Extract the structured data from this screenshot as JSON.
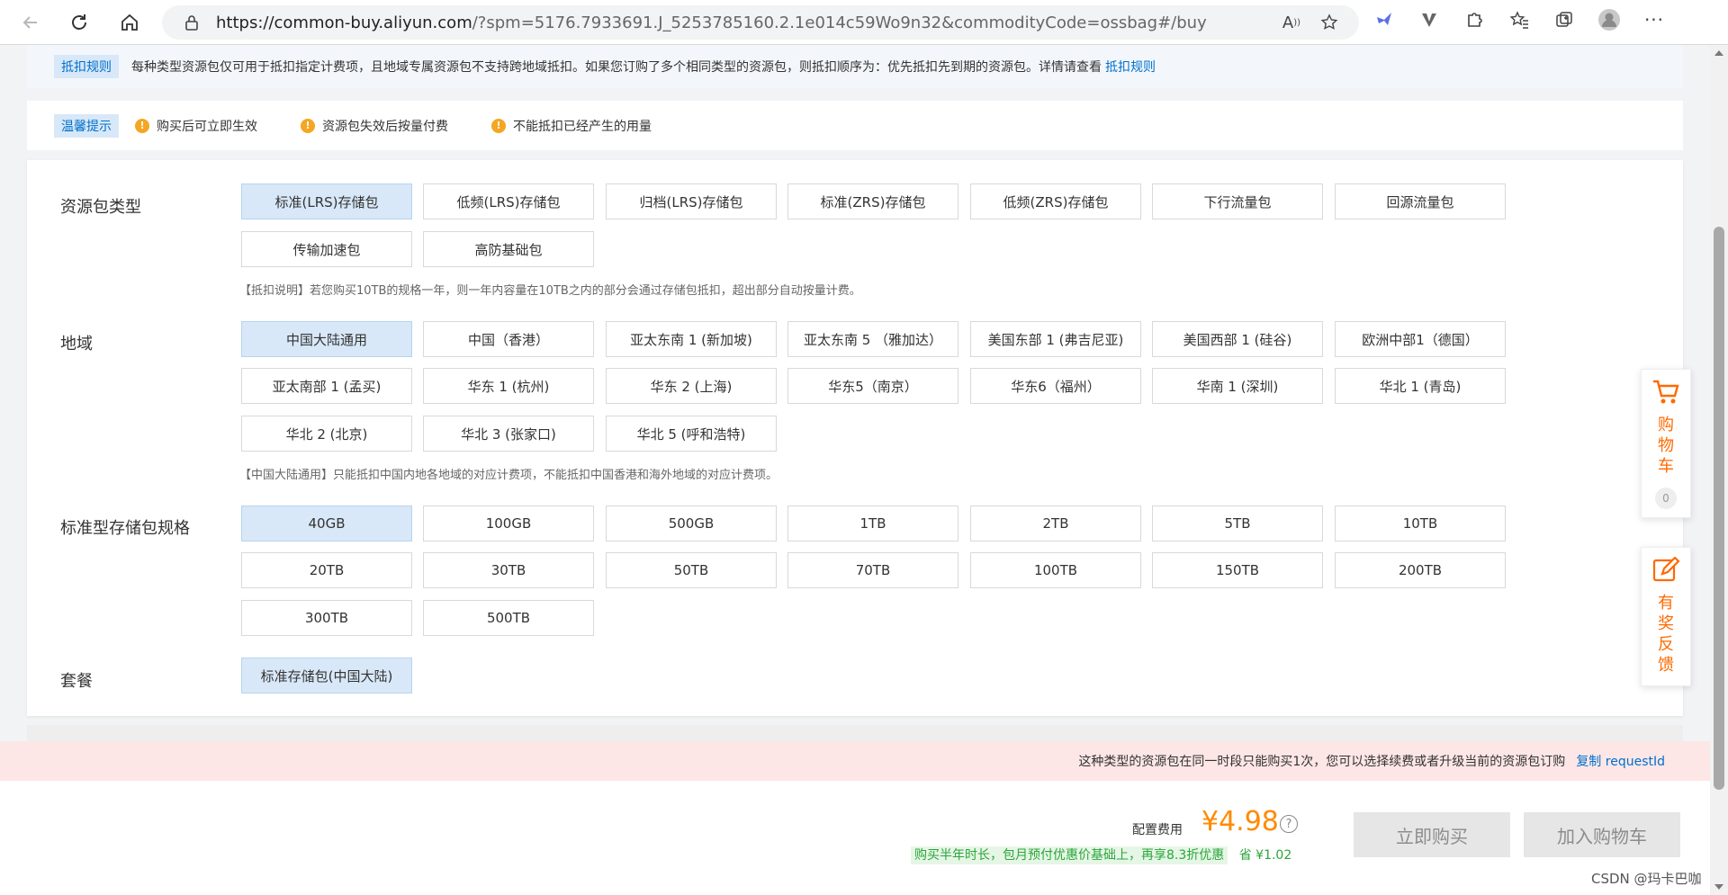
{
  "browser": {
    "url_host": "https://common-buy.aliyun.com",
    "url_rest": "/?spm=5176.7933691.J_5253785160.2.1e014c59Wo9n32&commodityCode=ossbag#/buy"
  },
  "rules": {
    "tag": "抵扣规则",
    "text": "每种类型资源包仅可用于抵扣指定计费项，且地域专属资源包不支持跨地域抵扣。如果您订购了多个相同类型的资源包，则抵扣顺序为：优先抵扣先到期的资源包。详情请查看",
    "link": "抵扣规则"
  },
  "tips": {
    "tag": "温馨提示",
    "items": [
      "购买后可立即生效",
      "资源包失效后按量付费",
      "不能抵扣已经产生的用量"
    ]
  },
  "package_type": {
    "label": "资源包类型",
    "options": [
      "标准(LRS)存储包",
      "低频(LRS)存储包",
      "归档(LRS)存储包",
      "标准(ZRS)存储包",
      "低频(ZRS)存储包",
      "下行流量包",
      "回源流量包",
      "传输加速包",
      "高防基础包"
    ],
    "selected": "标准(LRS)存储包",
    "note": "【抵扣说明】若您购买10TB的规格一年，则一年内容量在10TB之内的部分会通过存储包抵扣，超出部分自动按量计费。"
  },
  "region": {
    "label": "地域",
    "options": [
      "中国大陆通用",
      "中国（香港）",
      "亚太东南 1 (新加坡)",
      "亚太东南 5 （雅加达）",
      "美国东部 1 (弗吉尼亚)",
      "美国西部 1 (硅谷)",
      "欧洲中部1（德国）",
      "亚太南部 1 (孟买)",
      "华东 1 (杭州)",
      "华东 2 (上海)",
      "华东5（南京）",
      "华东6（福州）",
      "华南 1 (深圳)",
      "华北 1 (青岛)",
      "华北 2 (北京)",
      "华北 3 (张家口)",
      "华北 5 (呼和浩特)"
    ],
    "selected": "中国大陆通用",
    "note": "【中国大陆通用】只能抵扣中国内地各地域的对应计费项，不能抵扣中国香港和海外地域的对应计费项。"
  },
  "spec": {
    "label": "标准型存储包规格",
    "options": [
      "40GB",
      "100GB",
      "500GB",
      "1TB",
      "2TB",
      "5TB",
      "10TB",
      "20TB",
      "30TB",
      "50TB",
      "70TB",
      "100TB",
      "150TB",
      "200TB",
      "300TB",
      "500TB"
    ],
    "selected": "40GB"
  },
  "plan": {
    "label": "套餐",
    "options": [
      "标准存储包(中国大陆)"
    ],
    "selected": "标准存储包(中国大陆)"
  },
  "warning_banner": {
    "text": "这种类型的资源包在同一时段只能购买1次，您可以选择续费或者升级当前的资源包订购",
    "link": "复制 requestId"
  },
  "footer": {
    "price_label": "配置费用",
    "price": "¥4.98",
    "promo": "购买半年时长，包月预付优惠价基础上，再享8.3折优惠",
    "save": "省 ¥1.02",
    "buy_now": "立即购买",
    "add_cart": "加入购物车"
  },
  "float": {
    "cart": "购物车",
    "cart_count": "0",
    "feedback": "有奖反馈"
  },
  "watermark": "CSDN @玛卡巴咖",
  "colors": {
    "accent_blue": "#0070cc",
    "selected_bg": "#d8e8f8",
    "price_orange": "#ff8a00",
    "warn_bg": "#fde6e6"
  }
}
